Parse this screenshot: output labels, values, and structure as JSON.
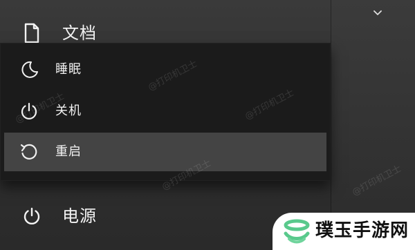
{
  "start_menu": {
    "docs_label": "文档",
    "power_label": "电源"
  },
  "power_menu": {
    "items": [
      {
        "label": "睡眠",
        "icon": "moon-icon"
      },
      {
        "label": "关机",
        "icon": "power-icon"
      },
      {
        "label": "重启",
        "icon": "restart-icon"
      }
    ],
    "highlighted_index": 2
  },
  "watermark_text": "@打印机卫士",
  "brand": {
    "name": "璞玉手游网",
    "icon": "logo-icon",
    "accent_color": "#59c98c"
  },
  "colors": {
    "menu_background": "#1b1b1b",
    "highlight_background": "#444444",
    "text": "#f2f2f2"
  }
}
